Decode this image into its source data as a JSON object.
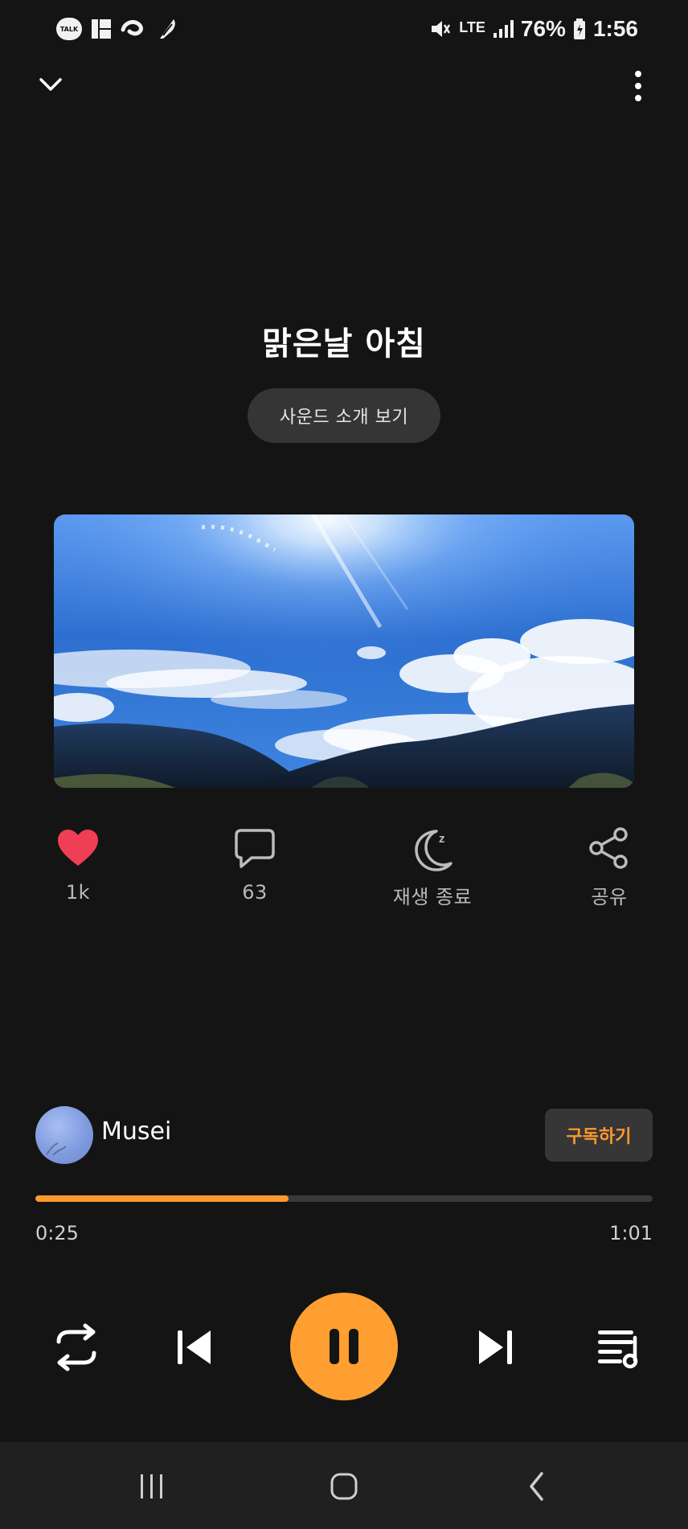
{
  "status_bar": {
    "time": "1:56",
    "battery": "76%",
    "network": "LTE",
    "kakao_badge": "TALK",
    "icons": [
      "kakao-talk-icon",
      "widgets-icon",
      "thread-icon",
      "feather-icon",
      "mute-icon",
      "lte-icon",
      "signal-icon",
      "battery-icon"
    ]
  },
  "header": {
    "down_icon": "chevron-down-icon",
    "more_icon": "more-vertical-icon"
  },
  "main": {
    "title": "맑은날 아침",
    "sound_intro_label": "사운드 소개 보기"
  },
  "artwork": {
    "description": "blue sky with clouds over mountains"
  },
  "actions": {
    "like_count": "1k",
    "comment_count": "63",
    "sleep_label": "재생 종료",
    "share_label": "공유"
  },
  "creator": {
    "name": "Musei",
    "subscribe_label": "구독하기"
  },
  "progress": {
    "current": "0:25",
    "duration": "1:01",
    "fraction": 0.4098
  },
  "controls": {
    "repeat": "repeat-icon",
    "previous": "previous-icon",
    "pause": "pause-icon",
    "next": "next-icon",
    "playlist": "playlist-icon"
  },
  "colors": {
    "background": "#141414",
    "accent": "#ff9f31",
    "like": "#ee3f55",
    "surface": "#353535"
  }
}
